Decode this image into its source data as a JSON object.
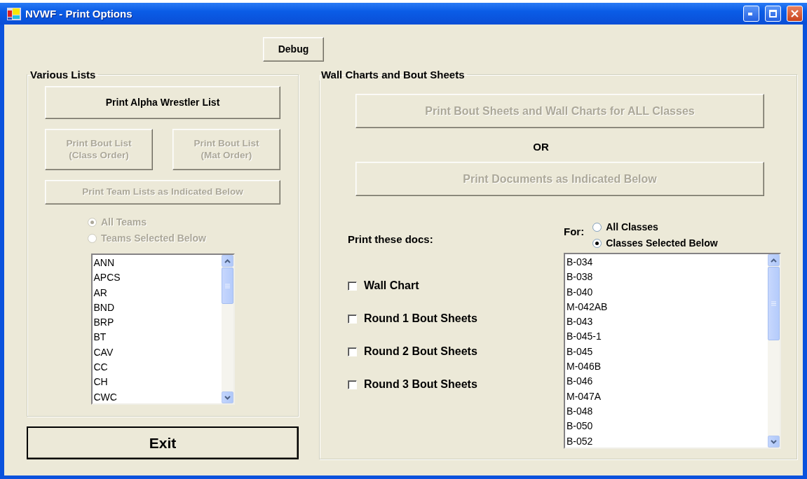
{
  "window": {
    "title": "NVWF - Print Options"
  },
  "debug_button": {
    "label": "Debug",
    "disabled": false
  },
  "various_lists": {
    "title": "Various Lists",
    "alpha_button": {
      "label": "Print Alpha Wrestler List",
      "disabled": false
    },
    "bout_list_buttons": [
      {
        "label": "Print Bout List\n(Class Order)",
        "disabled": true
      },
      {
        "label": "Print Bout List\n(Mat Order)",
        "disabled": true
      }
    ],
    "team_lists_button": {
      "label": "Print Team Lists as Indicated Below",
      "disabled": true
    },
    "team_scope": [
      {
        "label": "All Teams",
        "selected": true,
        "disabled": true
      },
      {
        "label": "Teams Selected Below",
        "selected": false,
        "disabled": true
      }
    ],
    "teams": [
      "ANN",
      "APCS",
      "AR",
      "BND",
      "BRP",
      "BT",
      "CAV",
      "CC",
      "CH",
      "CWC"
    ]
  },
  "exit_button": {
    "label": "Exit",
    "disabled": false
  },
  "wall_charts": {
    "title": "Wall Charts and Bout Sheets",
    "all_classes_button": {
      "label": "Print Bout Sheets and Wall Charts for ALL Classes",
      "disabled": true
    },
    "or_text": "OR",
    "documents_button": {
      "label": "Print Documents as Indicated Below",
      "disabled": true
    },
    "docs_label": "Print these docs:",
    "docs": [
      {
        "label": "Wall Chart",
        "checked": false
      },
      {
        "label": "Round 1 Bout Sheets",
        "checked": false
      },
      {
        "label": "Round 2 Bout Sheets",
        "checked": false
      },
      {
        "label": "Round 3 Bout Sheets",
        "checked": false
      }
    ],
    "for_label": "For:",
    "class_scope": [
      {
        "label": "All Classes",
        "selected": false,
        "disabled": false
      },
      {
        "label": "Classes Selected Below",
        "selected": true,
        "disabled": false
      }
    ],
    "classes": [
      "B-034",
      "B-038",
      "B-040",
      "M-042AB",
      "B-043",
      "B-045-1",
      "B-045",
      "M-046B",
      "B-046",
      "M-047A",
      "B-048",
      "B-050",
      "B-052"
    ]
  }
}
